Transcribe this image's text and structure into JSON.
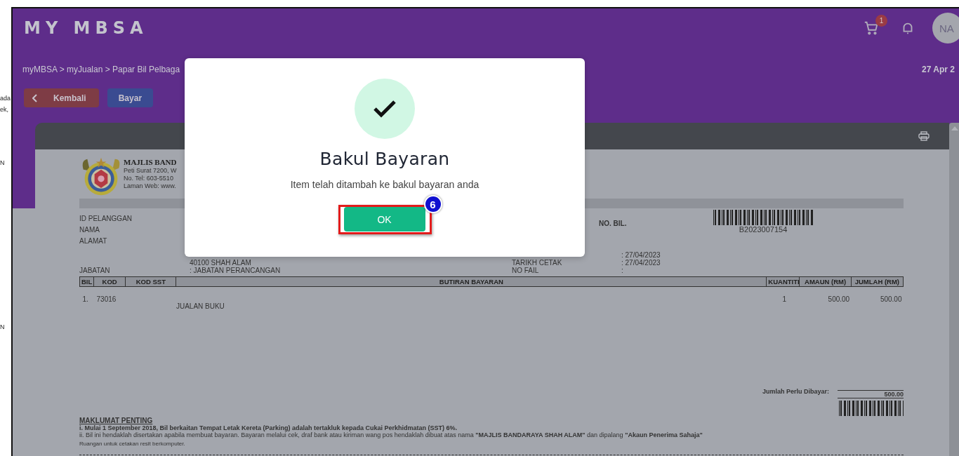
{
  "background_fragments": [
    "ada",
    "ek,",
    "N",
    "N"
  ],
  "header": {
    "logo": "MY MBSA",
    "cart_count": "1",
    "avatar": "NA",
    "breadcrumb": "myMBSA > myJualan > Papar Bil Pelbaga",
    "date": "27 Apr 2"
  },
  "actions": [
    {
      "label": "Kembali",
      "kind": "back"
    },
    {
      "label": "Bayar",
      "kind": "primary"
    }
  ],
  "bill": {
    "issuer": [
      "MAJLIS BAND",
      "Peti Surat 7200, W",
      "No. Tel: 603-5510",
      "Laman Web: www."
    ],
    "customer_fields": [
      "ID PELANGGAN",
      "NAMA",
      "ALAMAT"
    ],
    "bill_no_label": "NO. BIL.",
    "bill_no": "B2023007154",
    "info_rows": [
      {
        "value": ": 27/04/2023"
      },
      {
        "text": "40100 SHAH ALAM",
        "label": "TARIKH CETAK",
        "value": ": 27/04/2023"
      },
      {
        "title": "JABATAN",
        "text": ": JABATAN PERANCANGAN",
        "label": "NO FAIL",
        "value": ":"
      }
    ],
    "columns": [
      "BIL",
      "KOD",
      "KOD SST",
      "BUTIRAN BAYARAN",
      "KUANTITI",
      "AMAUN (RM)",
      "JUMLAH (RM)"
    ],
    "rows": [
      {
        "bil": "1.",
        "kod": "73016",
        "description": "JUALAN BUKU",
        "quantity": "1",
        "amount": "500.00",
        "total": "500.00"
      }
    ],
    "total_label": "Jumlah Perlu Dibayar:",
    "total": "500.00",
    "notes_title": "MAKLUMAT PENTING",
    "notes": [
      "i. Mulai 1 September 2018, Bil berkaitan Tempat Letak Kereta (Parking) adalah tertakluk kepada Cukai Perkhidmatan (SST) 6%.",
      "ii. Bil ini hendaklah disertakan apabila membuat bayaran. Bayaran melalui cek, draf bank atau kiriman wang pos hendaklah dibuat atas nama **\"MAJLIS BANDARAYA SHAH ALAM\"** dan dipalang **\"Akaun Penerima Sahaja\"**"
    ],
    "notes_bold": [
      true,
      false
    ],
    "receipt_note": "Ruangan untuk cetakan resit berkomputer."
  },
  "dialog": {
    "title": "Bakul Bayaran",
    "message": "Item telah ditambah ke bakul bayaran anda",
    "button": "OK",
    "annotation_step": "6"
  }
}
